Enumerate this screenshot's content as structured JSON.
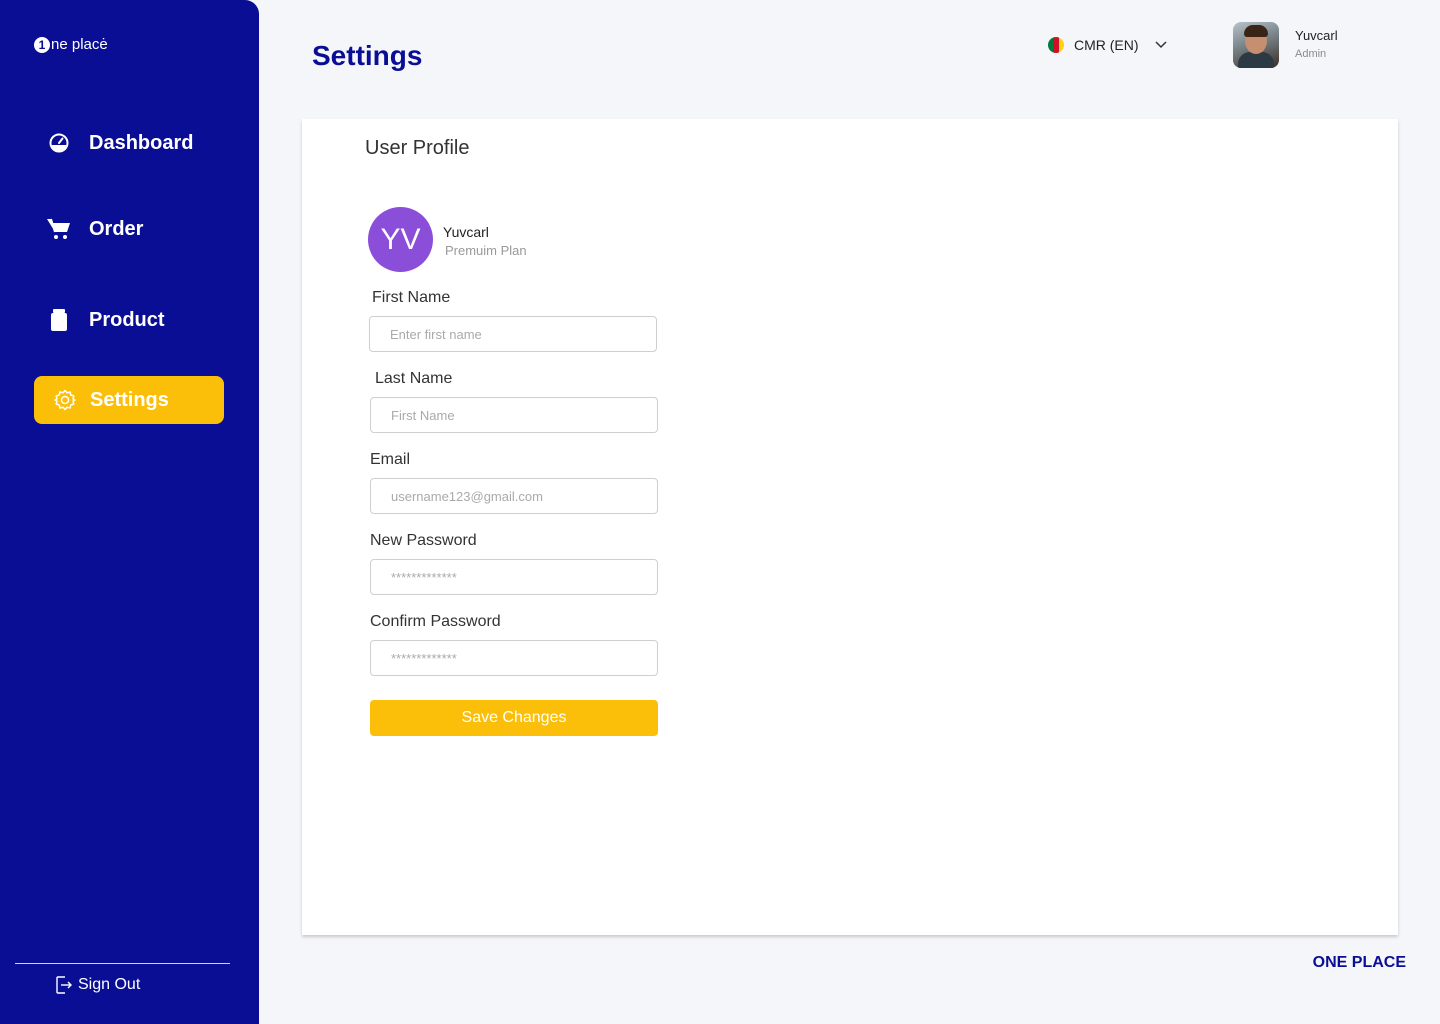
{
  "brand": {
    "logo_mark": "1",
    "logo_text": "ne placė",
    "footer": "ONE PLACE",
    "primary_color": "#0A0E94",
    "accent_color": "#FBBF09"
  },
  "sidebar": {
    "items": [
      {
        "label": "Dashboard",
        "icon": "dashboard-gauge-icon"
      },
      {
        "label": "Order",
        "icon": "cart-icon"
      },
      {
        "label": "Product",
        "icon": "product-jar-icon"
      },
      {
        "label": "Settings",
        "icon": "gear-icon",
        "active": true
      }
    ],
    "sign_out": "Sign Out"
  },
  "header": {
    "title": "Settings",
    "language": "CMR (EN)",
    "user": {
      "name": "Yuvcarl",
      "role": "Admin"
    }
  },
  "profile": {
    "section_title": "User Profile",
    "avatar_initials": "YV",
    "avatar_color": "#8B4ED9",
    "name": "Yuvcarl",
    "plan": "Premuim Plan"
  },
  "form": {
    "first_name": {
      "label": "First Name",
      "placeholder": "Enter first name",
      "value": ""
    },
    "last_name": {
      "label": "Last Name",
      "placeholder": "First Name",
      "value": ""
    },
    "email": {
      "label": "Email",
      "placeholder": "username123@gmail.com",
      "value": ""
    },
    "new_password": {
      "label": "New Password",
      "placeholder": "*************",
      "value": ""
    },
    "confirm_password": {
      "label": "Confirm Password",
      "placeholder": "*************",
      "value": ""
    },
    "save_label": "Save Changes"
  }
}
